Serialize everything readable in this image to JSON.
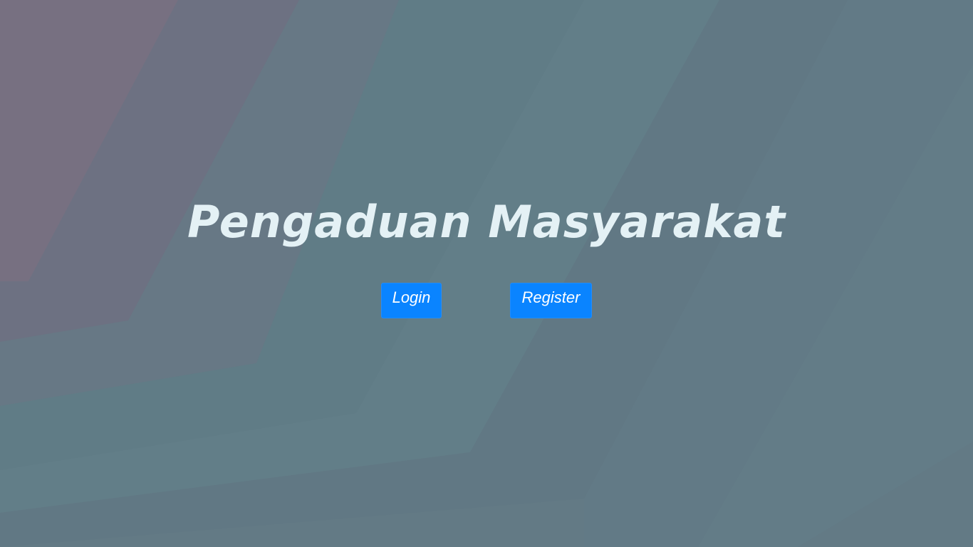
{
  "page": {
    "title": "Pengaduan Masyarakat"
  },
  "actions": {
    "login_label": "Login",
    "register_label": "Register"
  },
  "colors": {
    "background": "#637a85",
    "title_text": "#e4f1f5",
    "button_primary": "#0a84ff"
  }
}
